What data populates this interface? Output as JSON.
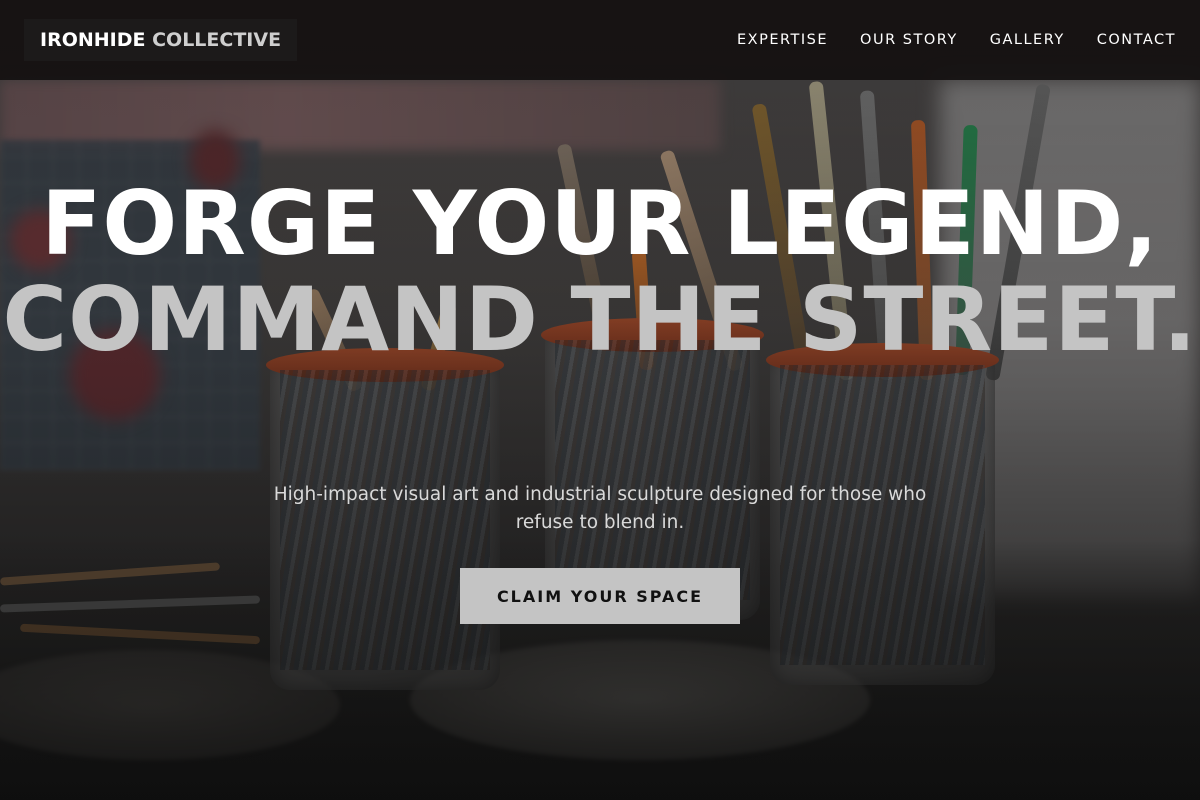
{
  "header": {
    "logo_primary": "IRONHIDE",
    "logo_secondary": "COLLECTIVE",
    "nav": [
      {
        "label": "EXPERTISE"
      },
      {
        "label": "OUR STORY"
      },
      {
        "label": "GALLERY"
      },
      {
        "label": "CONTACT"
      }
    ]
  },
  "hero": {
    "headline_line1": "FORGE YOUR LEGEND,",
    "headline_line2": "COMMAND THE STREET.",
    "subtitle": "High-impact visual art and industrial sculpture designed for those who refuse to blend in.",
    "cta_label": "CLAIM YOUR SPACE"
  },
  "colors": {
    "header_bg": "#141010",
    "headline_primary": "#ffffff",
    "headline_secondary": "#c4c4c4",
    "cta_bg": "#c4c4c4",
    "cta_text": "#111111"
  },
  "background": {
    "image_subject": "paint-brushes-in-jars-photo"
  }
}
